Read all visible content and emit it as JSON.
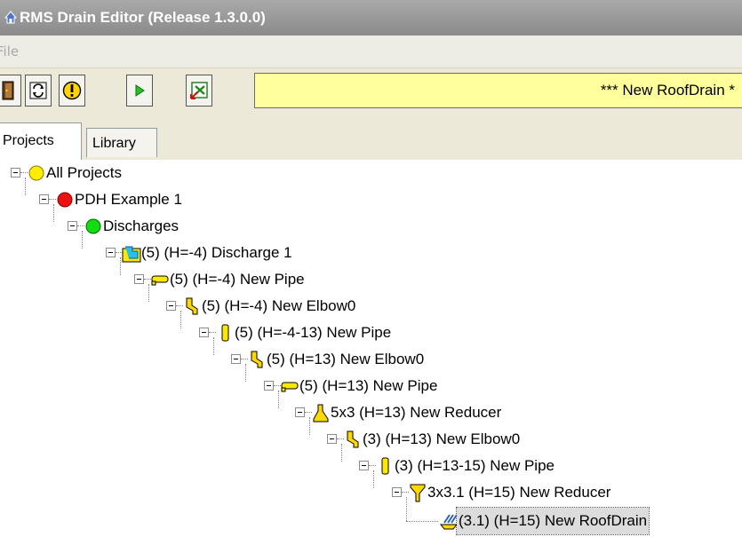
{
  "window": {
    "title": "RMS Drain Editor (Release 1.3.0.0)"
  },
  "menu": {
    "file": "File"
  },
  "toolbar": {
    "status_text": "*** New RoofDrain *",
    "status_color": "#ffff9c",
    "buttons": [
      {
        "icon": "exit-door-icon"
      },
      {
        "icon": "refresh-icon"
      },
      {
        "icon": "warning-icon"
      },
      {
        "icon": "play-icon"
      },
      {
        "icon": "export-icon"
      }
    ]
  },
  "tabs": [
    {
      "label": "Projects",
      "active": true
    },
    {
      "label": "Library",
      "active": false
    }
  ],
  "tree": {
    "nodes": [
      {
        "label": "All Projects",
        "icon": "yellow-circle-icon",
        "depth": 0
      },
      {
        "label": "PDH Example 1",
        "icon": "red-circle-icon",
        "depth": 1
      },
      {
        "label": "Discharges",
        "icon": "green-circle-icon",
        "depth": 2
      },
      {
        "label": "(5) (H=-4) Discharge 1",
        "icon": "discharge-icon",
        "depth": 3
      },
      {
        "label": "(5) (H=-4) New Pipe",
        "icon": "horizontal-pipe-icon",
        "depth": 4
      },
      {
        "label": "(5) (H=-4) New Elbow0",
        "icon": "elbow-icon",
        "depth": 5
      },
      {
        "label": "(5) (H=-4-13) New Pipe",
        "icon": "vertical-pipe-icon",
        "depth": 6
      },
      {
        "label": "(5) (H=13) New Elbow0",
        "icon": "elbow-icon",
        "depth": 7
      },
      {
        "label": "(5) (H=13) New Pipe",
        "icon": "horizontal-pipe-icon",
        "depth": 8
      },
      {
        "label": "5x3 (H=13) New Reducer",
        "icon": "reducer-icon",
        "depth": 9
      },
      {
        "label": "(3) (H=13) New Elbow0",
        "icon": "elbow-icon",
        "depth": 10
      },
      {
        "label": "(3) (H=13-15) New Pipe",
        "icon": "vertical-pipe-icon",
        "depth": 11
      },
      {
        "label": "3x3.1 (H=15) New Reducer",
        "icon": "funnel-reducer-icon",
        "depth": 12
      },
      {
        "label": "(3.1) (H=15) New RoofDrain",
        "icon": "roof-drain-icon",
        "depth": 13,
        "selected": true
      }
    ]
  }
}
